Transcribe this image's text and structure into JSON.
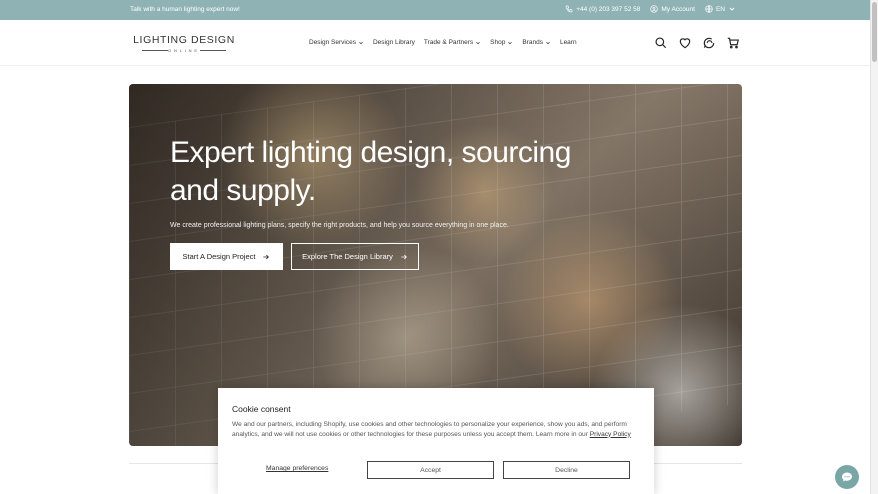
{
  "topbar": {
    "promo": "Talk with a human lighting expert now!",
    "phone": "+44 (0) 203 397 52 58",
    "account": "My Account",
    "language": "EN"
  },
  "header": {
    "logo_main": "LIGHTING DESIGN",
    "logo_sub": "ONLINE",
    "nav": [
      {
        "label": "Design Services",
        "dropdown": true
      },
      {
        "label": "Design Library",
        "dropdown": false
      },
      {
        "label": "Trade & Partners",
        "dropdown": true
      },
      {
        "label": "Shop",
        "dropdown": true
      },
      {
        "label": "Brands",
        "dropdown": true
      },
      {
        "label": "Learn",
        "dropdown": false
      }
    ],
    "icons": [
      "search-icon",
      "heart-icon",
      "chat-icon",
      "cart-icon"
    ]
  },
  "hero": {
    "title": "Expert lighting design, sourcing and supply.",
    "subtitle": "We create professional lighting plans, specify the right products, and help you source everything in one place.",
    "primary_button": "Start A Design Project",
    "secondary_button": "Explore The Design Library"
  },
  "cookie": {
    "title": "Cookie consent",
    "text": "We and our partners, including Shopify, use cookies and other technologies to personalize your experience, show you ads, and perform analytics, and we will not use cookies or other technologies for these purposes unless you accept them. Learn more in our ",
    "link": "Privacy Policy",
    "manage": "Manage preferences",
    "accept": "Accept",
    "decline": "Decline"
  },
  "colors": {
    "topbar": "#8fb3b5",
    "chat_bubble": "#7aa6a8"
  }
}
